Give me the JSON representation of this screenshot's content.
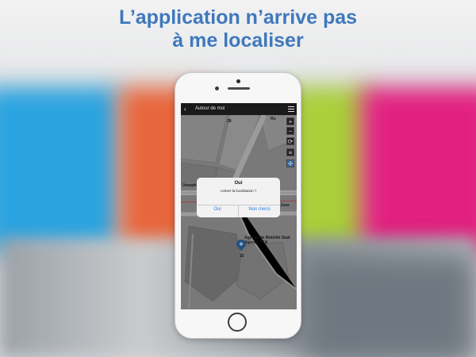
{
  "headline": {
    "line1": "L’application n’arrive pas",
    "line2": "à me localiser"
  },
  "app": {
    "title": "Autour de moi",
    "back_icon": "chevron-left-icon",
    "menu_icon": "hamburger-menu-icon"
  },
  "map": {
    "labels": {
      "block_28": "28",
      "block_15": "15",
      "street_partial": "Ru",
      "joseph1": "Joseph le Bar",
      "joseph2": "sl Jose",
      "place": "Agence de Mobilité Stati",
      "place2": "Agence TAN"
    },
    "controls": [
      "+",
      "−",
      "⟳",
      "≡",
      "✛"
    ]
  },
  "dialog": {
    "title": "Oui",
    "message": "Activer la localisation ?",
    "yes_label": "Oui",
    "no_label": "Non merci"
  },
  "colors": {
    "headline": "#3f78bd",
    "dialog_button": "#2d7be0",
    "navbar": "#1a1a1a"
  }
}
